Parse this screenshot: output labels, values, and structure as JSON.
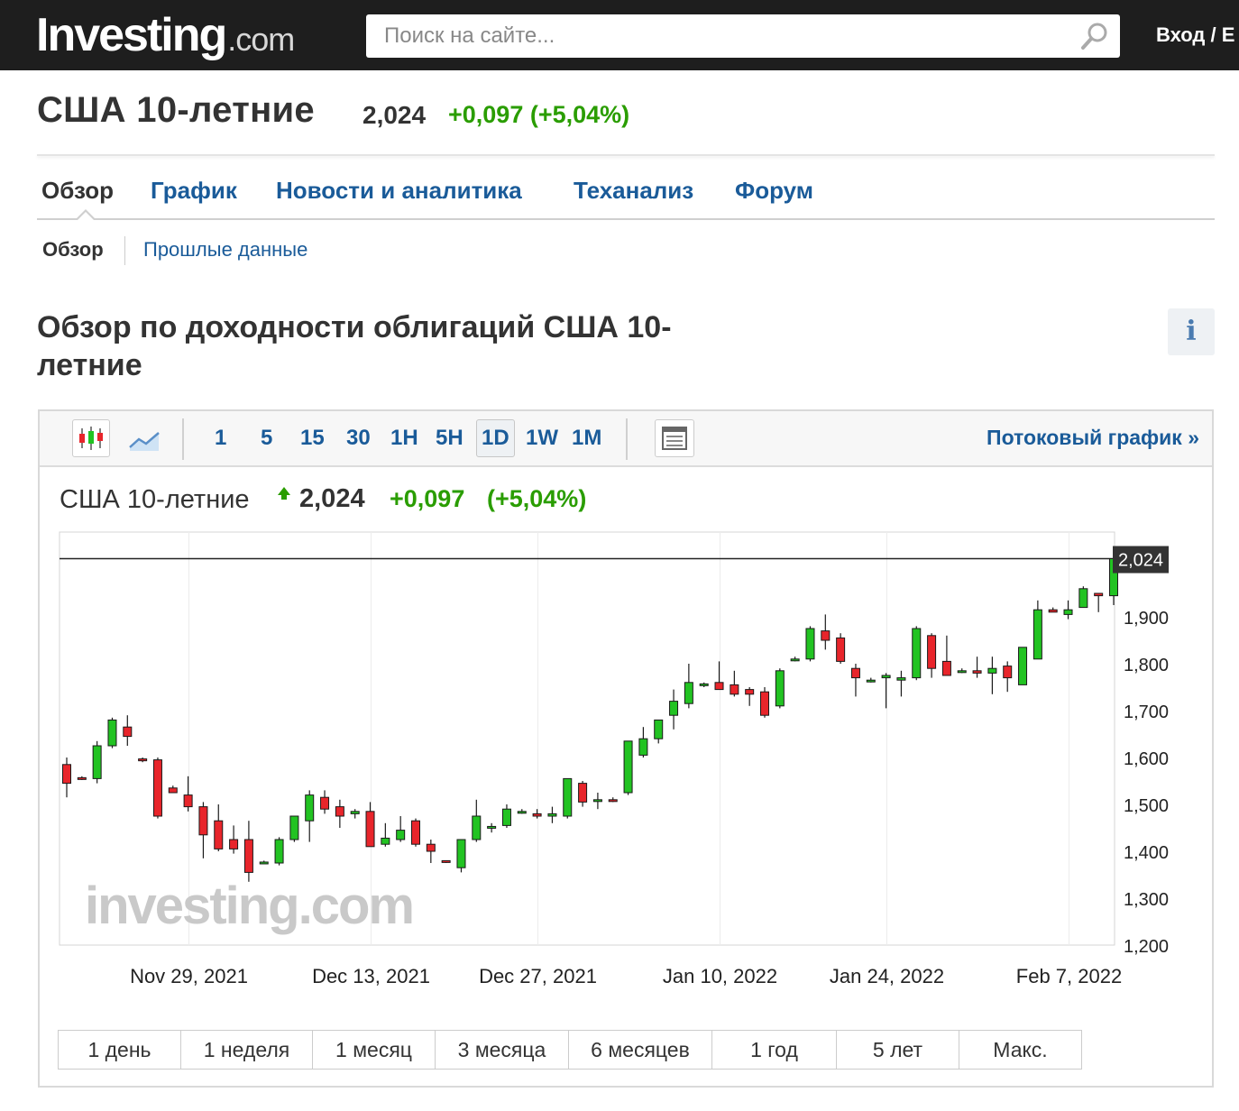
{
  "topbar": {
    "logo_main": "Investing",
    "logo_domain": ".com",
    "search_placeholder": "Поиск на сайте...",
    "login_label": "Вход / Е"
  },
  "instrument": {
    "title": "США 10-летние",
    "price": "2,024",
    "change": "+0,097 (+5,04%)"
  },
  "nav": {
    "tabs": [
      "Обзор",
      "График",
      "Новости и аналитика",
      "Теханализ",
      "Форум"
    ],
    "active_tab": "Обзор",
    "subtabs": [
      "Обзор",
      "Прошлые данные"
    ]
  },
  "section": {
    "title": "Обзор по доходности облигаций США 10-летние",
    "info_label": "i"
  },
  "chart_toolbar": {
    "intervals": [
      "1",
      "5",
      "15",
      "30",
      "1H",
      "5H",
      "1D",
      "1W",
      "1M"
    ],
    "active_interval": "1D",
    "stream_label": "Потоковый график »"
  },
  "chart_header": {
    "name": "США 10-летние",
    "price": "2,024",
    "change": "+0,097",
    "change_pct": "(+5,04%)"
  },
  "colors": {
    "up": "#22c322",
    "down": "#e8252b",
    "positive_text": "#2a9d00",
    "link": "#1a5b99",
    "topbar": "#1e1e1e"
  },
  "chart_data": {
    "type": "candlestick",
    "watermark": "investing.com",
    "current_price_label": "2,024",
    "current_price": 2.024,
    "ylim": [
      1.2,
      2.05
    ],
    "y_ticks": [
      1.2,
      1.3,
      1.4,
      1.5,
      1.6,
      1.7,
      1.8,
      1.9
    ],
    "y_tick_labels": [
      "1,200",
      "1,300",
      "1,400",
      "1,500",
      "1,600",
      "1,700",
      "1,800",
      "1,900"
    ],
    "x_ticks": [
      "Nov 29, 2021",
      "Dec 13, 2021",
      "Dec 27, 2021",
      "Jan 10, 2022",
      "Jan 24, 2022",
      "Feb 7, 2022"
    ],
    "x_tick_candle_index": [
      8,
      20,
      31,
      43,
      54,
      66
    ],
    "candles": [
      {
        "o": 1.585,
        "h": 1.6,
        "l": 1.515,
        "c": 1.545
      },
      {
        "o": 1.557,
        "h": 1.56,
        "l": 1.552,
        "c": 1.555
      },
      {
        "o": 1.555,
        "h": 1.635,
        "l": 1.545,
        "c": 1.625
      },
      {
        "o": 1.625,
        "h": 1.685,
        "l": 1.62,
        "c": 1.68
      },
      {
        "o": 1.665,
        "h": 1.69,
        "l": 1.625,
        "c": 1.645
      },
      {
        "o": 1.597,
        "h": 1.6,
        "l": 1.59,
        "c": 1.593
      },
      {
        "o": 1.595,
        "h": 1.6,
        "l": 1.47,
        "c": 1.475
      },
      {
        "o": 1.535,
        "h": 1.54,
        "l": 1.525,
        "c": 1.525
      },
      {
        "o": 1.52,
        "h": 1.56,
        "l": 1.485,
        "c": 1.495
      },
      {
        "o": 1.495,
        "h": 1.505,
        "l": 1.385,
        "c": 1.435
      },
      {
        "o": 1.465,
        "h": 1.5,
        "l": 1.4,
        "c": 1.405
      },
      {
        "o": 1.425,
        "h": 1.455,
        "l": 1.395,
        "c": 1.405
      },
      {
        "o": 1.425,
        "h": 1.465,
        "l": 1.335,
        "c": 1.355
      },
      {
        "o": 1.377,
        "h": 1.38,
        "l": 1.373,
        "c": 1.377
      },
      {
        "o": 1.375,
        "h": 1.43,
        "l": 1.37,
        "c": 1.425
      },
      {
        "o": 1.425,
        "h": 1.475,
        "l": 1.42,
        "c": 1.475
      },
      {
        "o": 1.465,
        "h": 1.53,
        "l": 1.42,
        "c": 1.52
      },
      {
        "o": 1.515,
        "h": 1.53,
        "l": 1.48,
        "c": 1.49
      },
      {
        "o": 1.495,
        "h": 1.51,
        "l": 1.45,
        "c": 1.475
      },
      {
        "o": 1.48,
        "h": 1.49,
        "l": 1.47,
        "c": 1.485
      },
      {
        "o": 1.485,
        "h": 1.505,
        "l": 1.41,
        "c": 1.41
      },
      {
        "o": 1.415,
        "h": 1.46,
        "l": 1.41,
        "c": 1.428
      },
      {
        "o": 1.425,
        "h": 1.475,
        "l": 1.42,
        "c": 1.445
      },
      {
        "o": 1.465,
        "h": 1.47,
        "l": 1.41,
        "c": 1.415
      },
      {
        "o": 1.415,
        "h": 1.425,
        "l": 1.375,
        "c": 1.4
      },
      {
        "o": 1.38,
        "h": 1.38,
        "l": 1.375,
        "c": 1.378
      },
      {
        "o": 1.365,
        "h": 1.425,
        "l": 1.355,
        "c": 1.425
      },
      {
        "o": 1.425,
        "h": 1.51,
        "l": 1.42,
        "c": 1.475
      },
      {
        "o": 1.45,
        "h": 1.46,
        "l": 1.44,
        "c": 1.453
      },
      {
        "o": 1.455,
        "h": 1.5,
        "l": 1.45,
        "c": 1.49
      },
      {
        "o": 1.485,
        "h": 1.49,
        "l": 1.48,
        "c": 1.485
      },
      {
        "o": 1.48,
        "h": 1.49,
        "l": 1.47,
        "c": 1.475
      },
      {
        "o": 1.475,
        "h": 1.495,
        "l": 1.46,
        "c": 1.48
      },
      {
        "o": 1.475,
        "h": 1.555,
        "l": 1.47,
        "c": 1.555
      },
      {
        "o": 1.545,
        "h": 1.55,
        "l": 1.495,
        "c": 1.505
      },
      {
        "o": 1.51,
        "h": 1.525,
        "l": 1.49,
        "c": 1.51
      },
      {
        "o": 1.51,
        "h": 1.515,
        "l": 1.505,
        "c": 1.508
      },
      {
        "o": 1.525,
        "h": 1.635,
        "l": 1.52,
        "c": 1.635
      },
      {
        "o": 1.605,
        "h": 1.665,
        "l": 1.6,
        "c": 1.64
      },
      {
        "o": 1.64,
        "h": 1.68,
        "l": 1.63,
        "c": 1.68
      },
      {
        "o": 1.69,
        "h": 1.745,
        "l": 1.66,
        "c": 1.72
      },
      {
        "o": 1.715,
        "h": 1.8,
        "l": 1.705,
        "c": 1.76
      },
      {
        "o": 1.755,
        "h": 1.76,
        "l": 1.75,
        "c": 1.757
      },
      {
        "o": 1.76,
        "h": 1.805,
        "l": 1.745,
        "c": 1.745
      },
      {
        "o": 1.755,
        "h": 1.785,
        "l": 1.73,
        "c": 1.735
      },
      {
        "o": 1.745,
        "h": 1.75,
        "l": 1.71,
        "c": 1.735
      },
      {
        "o": 1.74,
        "h": 1.75,
        "l": 1.685,
        "c": 1.69
      },
      {
        "o": 1.71,
        "h": 1.79,
        "l": 1.705,
        "c": 1.785
      },
      {
        "o": 1.81,
        "h": 1.815,
        "l": 1.805,
        "c": 1.81
      },
      {
        "o": 1.81,
        "h": 1.88,
        "l": 1.805,
        "c": 1.875
      },
      {
        "o": 1.87,
        "h": 1.905,
        "l": 1.83,
        "c": 1.85
      },
      {
        "o": 1.855,
        "h": 1.865,
        "l": 1.8,
        "c": 1.805
      },
      {
        "o": 1.79,
        "h": 1.8,
        "l": 1.73,
        "c": 1.77
      },
      {
        "o": 1.765,
        "h": 1.77,
        "l": 1.76,
        "c": 1.765
      },
      {
        "o": 1.77,
        "h": 1.78,
        "l": 1.705,
        "c": 1.775
      },
      {
        "o": 1.765,
        "h": 1.785,
        "l": 1.73,
        "c": 1.77
      },
      {
        "o": 1.77,
        "h": 1.88,
        "l": 1.765,
        "c": 1.875
      },
      {
        "o": 1.86,
        "h": 1.865,
        "l": 1.77,
        "c": 1.79
      },
      {
        "o": 1.805,
        "h": 1.86,
        "l": 1.775,
        "c": 1.775
      },
      {
        "o": 1.785,
        "h": 1.79,
        "l": 1.78,
        "c": 1.785
      },
      {
        "o": 1.785,
        "h": 1.815,
        "l": 1.77,
        "c": 1.78
      },
      {
        "o": 1.78,
        "h": 1.815,
        "l": 1.735,
        "c": 1.79
      },
      {
        "o": 1.795,
        "h": 1.805,
        "l": 1.74,
        "c": 1.77
      },
      {
        "o": 1.755,
        "h": 1.835,
        "l": 1.755,
        "c": 1.835
      },
      {
        "o": 1.81,
        "h": 1.935,
        "l": 1.81,
        "c": 1.915
      },
      {
        "o": 1.915,
        "h": 1.92,
        "l": 1.91,
        "c": 1.91
      },
      {
        "o": 1.905,
        "h": 1.935,
        "l": 1.895,
        "c": 1.915
      },
      {
        "o": 1.92,
        "h": 1.965,
        "l": 1.92,
        "c": 1.96
      },
      {
        "o": 1.95,
        "h": 1.95,
        "l": 1.91,
        "c": 1.945
      },
      {
        "o": 1.945,
        "h": 2.035,
        "l": 1.925,
        "c": 2.024
      }
    ]
  },
  "ranges": [
    "1 день",
    "1 неделя",
    "1 месяц",
    "3 месяца",
    "6 месяцев",
    "1 год",
    "5 лет",
    "Макс."
  ]
}
